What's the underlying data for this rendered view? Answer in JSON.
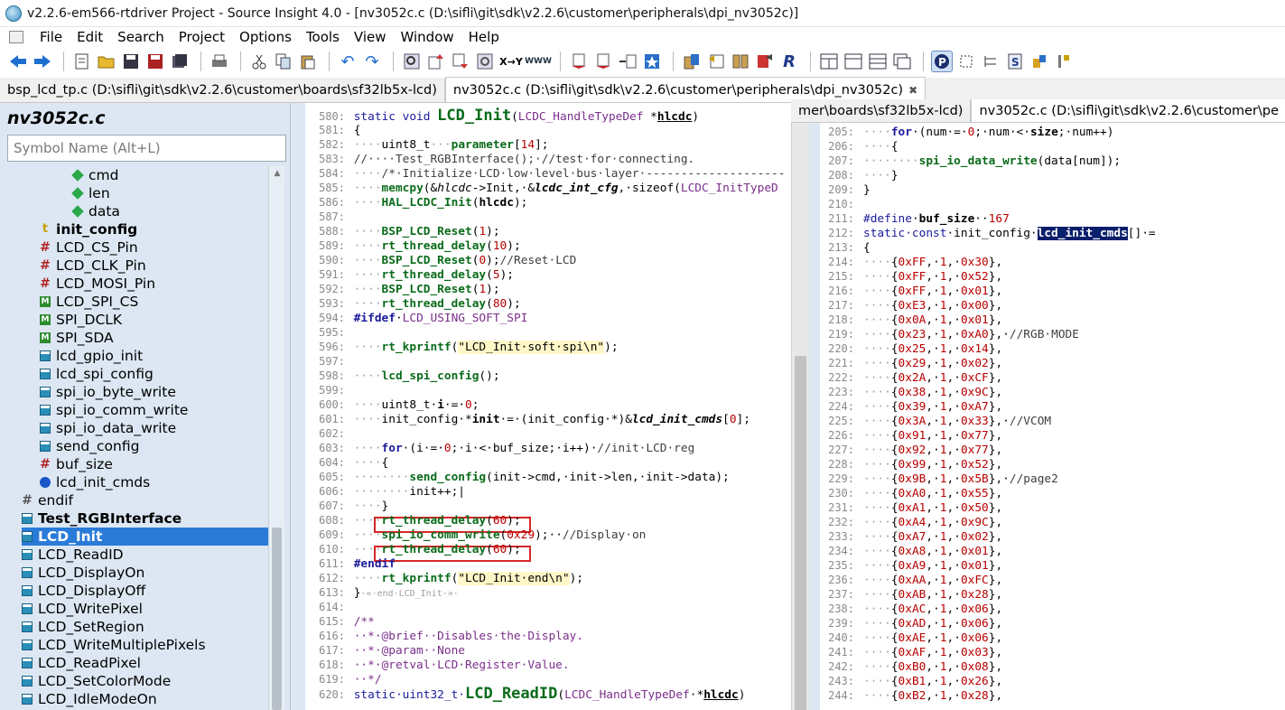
{
  "window": {
    "title": "v2.2.6-em566-rtdriver Project - Source Insight 4.0 - [nv3052c.c (D:\\sifli\\git\\sdk\\v2.2.6\\customer\\peripherals\\dpi_nv3052c)]"
  },
  "menu": [
    "File",
    "Edit",
    "Search",
    "Project",
    "Options",
    "Tools",
    "View",
    "Window",
    "Help"
  ],
  "tabs": [
    {
      "label": "bsp_lcd_tp.c (D:\\sifli\\git\\sdk\\v2.2.6\\customer\\boards\\sf32lb5x-lcd)",
      "active": false
    },
    {
      "label": "nv3052c.c (D:\\sifli\\git\\sdk\\v2.2.6\\customer\\peripherals\\dpi_nv3052c)",
      "active": true,
      "close": "✖"
    }
  ],
  "right_tabs": [
    {
      "label": "mer\\boards\\sf32lb5x-lcd)",
      "active": false
    },
    {
      "label": "nv3052c.c (D:\\sifli\\git\\sdk\\v2.2.6\\customer\\pe",
      "active": true
    }
  ],
  "symbol_panel": {
    "file_title": "nv3052c.c",
    "search_placeholder": "Symbol Name (Alt+L)",
    "symbols": [
      {
        "label": "cmd",
        "icon": "diamond",
        "indent": 2
      },
      {
        "label": "len",
        "icon": "diamond",
        "indent": 2
      },
      {
        "label": "data",
        "icon": "diamond",
        "indent": 2
      },
      {
        "label": "init_config",
        "icon": "typedef",
        "indent": 1,
        "bold": true
      },
      {
        "label": "LCD_CS_Pin",
        "icon": "hash",
        "indent": 1
      },
      {
        "label": "LCD_CLK_Pin",
        "icon": "hash",
        "indent": 1
      },
      {
        "label": "LCD_MOSI_Pin",
        "icon": "hash",
        "indent": 1
      },
      {
        "label": "LCD_SPI_CS",
        "icon": "macro",
        "indent": 1
      },
      {
        "label": "SPI_DCLK",
        "icon": "macro",
        "indent": 1
      },
      {
        "label": "SPI_SDA",
        "icon": "macro",
        "indent": 1
      },
      {
        "label": "lcd_gpio_init",
        "icon": "func",
        "indent": 1
      },
      {
        "label": "lcd_spi_config",
        "icon": "func",
        "indent": 1
      },
      {
        "label": "spi_io_byte_write",
        "icon": "func",
        "indent": 1
      },
      {
        "label": "spi_io_comm_write",
        "icon": "func",
        "indent": 1
      },
      {
        "label": "spi_io_data_write",
        "icon": "func",
        "indent": 1
      },
      {
        "label": "send_config",
        "icon": "func",
        "indent": 1
      },
      {
        "label": "buf_size",
        "icon": "hash",
        "indent": 1
      },
      {
        "label": "lcd_init_cmds",
        "icon": "var",
        "indent": 1
      },
      {
        "label": "endif",
        "icon": "endif",
        "indent": 0
      },
      {
        "label": "Test_RGBInterface",
        "icon": "func",
        "indent": 0,
        "bold": true
      },
      {
        "label": "LCD_Init",
        "icon": "func",
        "indent": 0,
        "bold": true,
        "selected": true
      },
      {
        "label": "LCD_ReadID",
        "icon": "func",
        "indent": 0
      },
      {
        "label": "LCD_DisplayOn",
        "icon": "func",
        "indent": 0
      },
      {
        "label": "LCD_DisplayOff",
        "icon": "func",
        "indent": 0
      },
      {
        "label": "LCD_WritePixel",
        "icon": "func",
        "indent": 0
      },
      {
        "label": "LCD_SetRegion",
        "icon": "func",
        "indent": 0
      },
      {
        "label": "LCD_WriteMultiplePixels",
        "icon": "func",
        "indent": 0
      },
      {
        "label": "LCD_ReadPixel",
        "icon": "func",
        "indent": 0
      },
      {
        "label": "LCD_SetColorMode",
        "icon": "func",
        "indent": 0
      },
      {
        "label": "LCD_IdleModeOn",
        "icon": "func",
        "indent": 0
      }
    ]
  },
  "editor_left": {
    "lines": [
      {
        "n": "580:",
        "h": "<span class='kw'>static void </span><span class='fn' style='font-size:17px'>LCD_Init</span>(<span class='mac'>LCDC_HandleTypeDef</span> *<b><u>hlcdc</u></b>)"
      },
      {
        "n": "581:",
        "h": "{"
      },
      {
        "n": "582:",
        "h": "<span class='dot'>····</span>uint8_t<span class='dot'>···</span><span class='fn'>parameter</span>[<span class='num'>14</span>];"
      },
      {
        "n": "583:",
        "h": "<span class='cmt'>//····Test_RGBInterface();·//test·for·connecting.</span>"
      },
      {
        "n": "584:",
        "h": "<span class='dot'>····</span><span class='cmt'>/*·Initialize·LCD·low·level·bus·layer·--------------------</span>"
      },
      {
        "n": "585:",
        "h": "<span class='dot'>····</span><span class='fn'>memcpy</span>(&amp;<i>hlcdc</i>-&gt;Init,·&amp;<b><i>lcdc_int_cfg</i></b>,·sizeof(<span class='mac'>LCDC_InitTypeD</span>"
      },
      {
        "n": "586:",
        "h": "<span class='dot'>····</span><span class='fn'>HAL_LCDC_Init</span>(<b>hlcdc</b>);"
      },
      {
        "n": "587:",
        "h": ""
      },
      {
        "n": "588:",
        "h": "<span class='dot'>····</span><span class='fn'>BSP_LCD_Reset</span>(<span class='num'>1</span>);"
      },
      {
        "n": "589:",
        "h": "<span class='dot'>····</span><span class='fn'>rt_thread_delay</span>(<span class='num'>10</span>);"
      },
      {
        "n": "590:",
        "h": "<span class='dot'>····</span><span class='fn'>BSP_LCD_Reset</span>(<span class='num'>0</span>);<span class='cmt'>//Reset·LCD</span>"
      },
      {
        "n": "591:",
        "h": "<span class='dot'>····</span><span class='fn'>rt_thread_delay</span>(<span class='num'>5</span>);"
      },
      {
        "n": "592:",
        "h": "<span class='dot'>····</span><span class='fn'>BSP_LCD_Reset</span>(<span class='num'>1</span>);"
      },
      {
        "n": "593:",
        "h": "<span class='dot'>····</span><span class='fn'>rt_thread_delay</span>(<span class='num'>80</span>);"
      },
      {
        "n": "594:",
        "h": "<span class='kw'><b>#ifdef</b></span>·<span class='mac'>LCD_USING_SOFT_SPI</span>"
      },
      {
        "n": "595:",
        "h": ""
      },
      {
        "n": "596:",
        "h": "<span class='dot'>····</span><span class='fn'>rt_kprintf</span>(<span class='str'>\"LCD_Init·soft·spi\\n\"</span>);"
      },
      {
        "n": "597:",
        "h": ""
      },
      {
        "n": "598:",
        "h": "<span class='dot'>····</span><span class='fn'>lcd_spi_config</span>();"
      },
      {
        "n": "599:",
        "h": ""
      },
      {
        "n": "600:",
        "h": "<span class='dot'>····</span>uint8_t·<b>i</b>·=·<span class='num'>0</span>;"
      },
      {
        "n": "601:",
        "h": "<span class='dot'>····</span>init_config·*<b>init</b>·=·(init_config·*)&amp;<b><i>lcd_init_cmds</i></b>[<span class='num'>0</span>];"
      },
      {
        "n": "602:",
        "h": ""
      },
      {
        "n": "603:",
        "h": "<span class='dot'>····</span><span class='kw'><b>for</b></span>·(i·=·<span class='num'>0</span>;·i·&lt;·buf_size;·i++)·<span class='cmt'>//init·LCD·reg</span>"
      },
      {
        "n": "604:",
        "h": "<span class='dot'>····</span>{"
      },
      {
        "n": "605:",
        "h": "<span class='dot'>········</span><span class='fn'>send_config</span>(init-&gt;cmd,·init-&gt;len,·init-&gt;data);"
      },
      {
        "n": "606:",
        "h": "<span class='dot'>········</span>init++;|"
      },
      {
        "n": "607:",
        "h": "<span class='dot'>····</span>}"
      },
      {
        "n": "608:",
        "h": "<span class='dot'>····</span><span class='fn'>rt_thread_delay</span>(<span class='num'>60</span>);"
      },
      {
        "n": "609:",
        "h": "<span class='dot'>····</span><span class='fn'>spi_io_comm_write</span>(<span class='num'>0x29</span>);··<span class='cmt'>//Display·on</span>"
      },
      {
        "n": "610:",
        "h": "<span class='dot'>····</span><span class='fn'>rt_thread_delay</span>(<span class='num'>60</span>);"
      },
      {
        "n": "611:",
        "h": "<span class='kw'><b>#endif</b></span>"
      },
      {
        "n": "612:",
        "h": "<span class='dot'>····</span><span class='fn'>rt_kprintf</span>(<span class='str'>\"LCD_Init·end\\n\"</span>);"
      },
      {
        "n": "613:",
        "h": "}<span class='dot' style='font-size:10px'>·«·end·LCD_Init·»·</span>"
      },
      {
        "n": "614:",
        "h": ""
      },
      {
        "n": "615:",
        "h": "<span class='mac'>/**</span>"
      },
      {
        "n": "616:",
        "h": "<span class='mac'>··*·@brief··Disables·the·Display.</span>"
      },
      {
        "n": "617:",
        "h": "<span class='mac'>··*·@param··None</span>"
      },
      {
        "n": "618:",
        "h": "<span class='mac'>··*·@retval·LCD·Register·Value.</span>"
      },
      {
        "n": "619:",
        "h": "<span class='mac'>··*/</span>"
      },
      {
        "n": "620:",
        "h": "<span class='kw'>static·uint32_t·</span><span class='fn' style='font-size:17px'>LCD_ReadID</span>(<span class='mac'>LCDC_HandleTypeDef</span>·*<b><u>hlcdc</u></b>)"
      }
    ]
  },
  "editor_right": {
    "lines": [
      {
        "n": "205:",
        "h": "<span class='dot'>····</span><span class='kw'><b>for</b></span>·(num·=·<span class='num'>0</span>;·num·&lt;·<b>size</b>;·num++)"
      },
      {
        "n": "206:",
        "h": "<span class='dot'>····</span>{"
      },
      {
        "n": "207:",
        "h": "<span class='dot'>········</span><span class='fn'>spi_io_data_write</span>(data[num]);"
      },
      {
        "n": "208:",
        "h": "<span class='dot'>····</span>}"
      },
      {
        "n": "209:",
        "h": "}"
      },
      {
        "n": "210:",
        "h": ""
      },
      {
        "n": "211:",
        "h": "<span class='kw'>#define</span>·<b>buf_size</b>··<span class='num'>167</span>"
      },
      {
        "n": "212:",
        "h": "<span class='kw'>static·const</span>·init_config·<span class='sel-word'>lcd_init_cmds</span>[]·="
      },
      {
        "n": "213:",
        "h": "{"
      },
      {
        "n": "214:",
        "h": "<span class='dot'>····</span>{<span class='hexnum'>0xFF</span>,·<span class='num'>1</span>,·<span class='hexnum'>0x30</span>},"
      },
      {
        "n": "215:",
        "h": "<span class='dot'>····</span>{<span class='hexnum'>0xFF</span>,·<span class='num'>1</span>,·<span class='hexnum'>0x52</span>},"
      },
      {
        "n": "216:",
        "h": "<span class='dot'>····</span>{<span class='hexnum'>0xFF</span>,·<span class='num'>1</span>,·<span class='hexnum'>0x01</span>},"
      },
      {
        "n": "217:",
        "h": "<span class='dot'>····</span>{<span class='hexnum'>0xE3</span>,·<span class='num'>1</span>,·<span class='hexnum'>0x00</span>},"
      },
      {
        "n": "218:",
        "h": "<span class='dot'>····</span>{<span class='hexnum'>0x0A</span>,·<span class='num'>1</span>,·<span class='hexnum'>0x01</span>},"
      },
      {
        "n": "219:",
        "h": "<span class='dot'>····</span>{<span class='hexnum'>0x23</span>,·<span class='num'>1</span>,·<span class='hexnum'>0xA0</span>},·<span class='cmt'>//RGB·MODE</span>"
      },
      {
        "n": "220:",
        "h": "<span class='dot'>····</span>{<span class='hexnum'>0x25</span>,·<span class='num'>1</span>,·<span class='hexnum'>0x14</span>},"
      },
      {
        "n": "221:",
        "h": "<span class='dot'>····</span>{<span class='hexnum'>0x29</span>,·<span class='num'>1</span>,·<span class='hexnum'>0x02</span>},"
      },
      {
        "n": "222:",
        "h": "<span class='dot'>····</span>{<span class='hexnum'>0x2A</span>,·<span class='num'>1</span>,·<span class='hexnum'>0xCF</span>},"
      },
      {
        "n": "223:",
        "h": "<span class='dot'>····</span>{<span class='hexnum'>0x38</span>,·<span class='num'>1</span>,·<span class='hexnum'>0x9C</span>},"
      },
      {
        "n": "224:",
        "h": "<span class='dot'>····</span>{<span class='hexnum'>0x39</span>,·<span class='num'>1</span>,·<span class='hexnum'>0xA7</span>},"
      },
      {
        "n": "225:",
        "h": "<span class='dot'>····</span>{<span class='hexnum'>0x3A</span>,·<span class='num'>1</span>,·<span class='hexnum'>0x33</span>},·<span class='cmt'>//VCOM</span>"
      },
      {
        "n": "226:",
        "h": "<span class='dot'>····</span>{<span class='hexnum'>0x91</span>,·<span class='num'>1</span>,·<span class='hexnum'>0x77</span>},"
      },
      {
        "n": "227:",
        "h": "<span class='dot'>····</span>{<span class='hexnum'>0x92</span>,·<span class='num'>1</span>,·<span class='hexnum'>0x77</span>},"
      },
      {
        "n": "228:",
        "h": "<span class='dot'>····</span>{<span class='hexnum'>0x99</span>,·<span class='num'>1</span>,·<span class='hexnum'>0x52</span>},"
      },
      {
        "n": "229:",
        "h": "<span class='dot'>····</span>{<span class='hexnum'>0x9B</span>,·<span class='num'>1</span>,·<span class='hexnum'>0x5B</span>},·<span class='cmt'>//page2</span>"
      },
      {
        "n": "230:",
        "h": "<span class='dot'>····</span>{<span class='hexnum'>0xA0</span>,·<span class='num'>1</span>,·<span class='hexnum'>0x55</span>},"
      },
      {
        "n": "231:",
        "h": "<span class='dot'>····</span>{<span class='hexnum'>0xA1</span>,·<span class='num'>1</span>,·<span class='hexnum'>0x50</span>},"
      },
      {
        "n": "232:",
        "h": "<span class='dot'>····</span>{<span class='hexnum'>0xA4</span>,·<span class='num'>1</span>,·<span class='hexnum'>0x9C</span>},"
      },
      {
        "n": "233:",
        "h": "<span class='dot'>····</span>{<span class='hexnum'>0xA7</span>,·<span class='num'>1</span>,·<span class='hexnum'>0x02</span>},"
      },
      {
        "n": "234:",
        "h": "<span class='dot'>····</span>{<span class='hexnum'>0xA8</span>,·<span class='num'>1</span>,·<span class='hexnum'>0x01</span>},"
      },
      {
        "n": "235:",
        "h": "<span class='dot'>····</span>{<span class='hexnum'>0xA9</span>,·<span class='num'>1</span>,·<span class='hexnum'>0x01</span>},"
      },
      {
        "n": "236:",
        "h": "<span class='dot'>····</span>{<span class='hexnum'>0xAA</span>,·<span class='num'>1</span>,·<span class='hexnum'>0xFC</span>},"
      },
      {
        "n": "237:",
        "h": "<span class='dot'>····</span>{<span class='hexnum'>0xAB</span>,·<span class='num'>1</span>,·<span class='hexnum'>0x28</span>},"
      },
      {
        "n": "238:",
        "h": "<span class='dot'>····</span>{<span class='hexnum'>0xAC</span>,·<span class='num'>1</span>,·<span class='hexnum'>0x06</span>},"
      },
      {
        "n": "239:",
        "h": "<span class='dot'>····</span>{<span class='hexnum'>0xAD</span>,·<span class='num'>1</span>,·<span class='hexnum'>0x06</span>},"
      },
      {
        "n": "240:",
        "h": "<span class='dot'>····</span>{<span class='hexnum'>0xAE</span>,·<span class='num'>1</span>,·<span class='hexnum'>0x06</span>},"
      },
      {
        "n": "241:",
        "h": "<span class='dot'>····</span>{<span class='hexnum'>0xAF</span>,·<span class='num'>1</span>,·<span class='hexnum'>0x03</span>},"
      },
      {
        "n": "242:",
        "h": "<span class='dot'>····</span>{<span class='hexnum'>0xB0</span>,·<span class='num'>1</span>,·<span class='hexnum'>0x08</span>},"
      },
      {
        "n": "243:",
        "h": "<span class='dot'>····</span>{<span class='hexnum'>0xB1</span>,·<span class='num'>1</span>,·<span class='hexnum'>0x26</span>},"
      },
      {
        "n": "244:",
        "h": "<span class='dot'>····</span>{<span class='hexnum'>0xB2</span>,·<span class='num'>1</span>,·<span class='hexnum'>0x28</span>},"
      }
    ]
  }
}
